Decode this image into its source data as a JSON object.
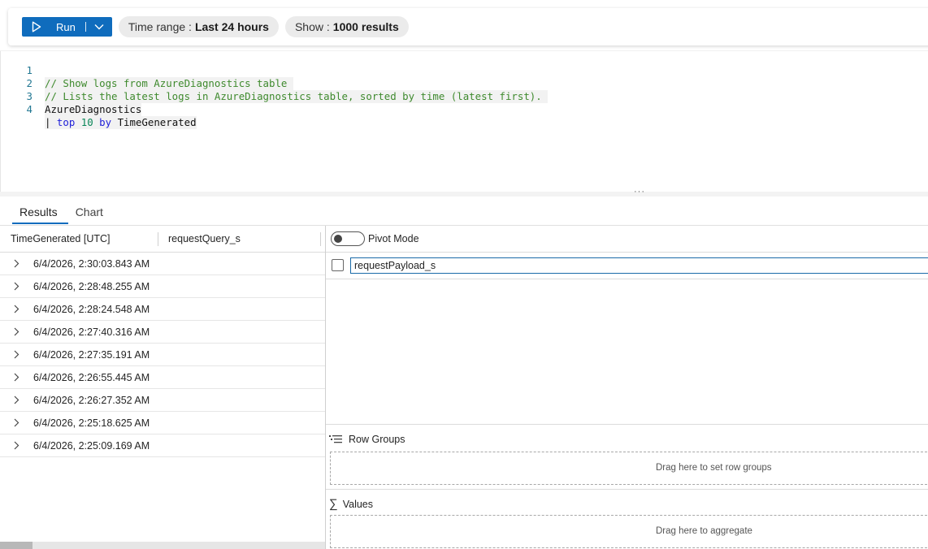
{
  "toolbar": {
    "run_label": "Run",
    "time_range_label": "Time range :",
    "time_range_value": "Last 24 hours",
    "show_label": "Show :",
    "show_value": "1000 results"
  },
  "editor": {
    "lines": [
      {
        "num": "1",
        "text": "// Show logs from AzureDiagnostics table "
      },
      {
        "num": "2",
        "text": "// Lists the latest logs in AzureDiagnostics table, sorted by time (latest first). "
      },
      {
        "num": "3",
        "text": "AzureDiagnostics"
      },
      {
        "num": "4",
        "pipe": "| ",
        "kw1": "top",
        "n": "10",
        "kw2": "by",
        "field": "TimeGenerated"
      }
    ]
  },
  "tabs": [
    {
      "label": "Results",
      "active": true
    },
    {
      "label": "Chart",
      "active": false
    }
  ],
  "grid": {
    "columns": [
      "TimeGenerated [UTC]",
      "requestQuery_s"
    ],
    "rows": [
      "6/4/2026, 2:30:03.843 AM",
      "6/4/2026, 2:28:48.255 AM",
      "6/4/2026, 2:28:24.548 AM",
      "6/4/2026, 2:27:40.316 AM",
      "6/4/2026, 2:27:35.191 AM",
      "6/4/2026, 2:26:55.445 AM",
      "6/4/2026, 2:26:27.352 AM",
      "6/4/2026, 2:25:18.625 AM",
      "6/4/2026, 2:25:09.169 AM"
    ]
  },
  "panel": {
    "pivot_label": "Pivot Mode",
    "column_search_value": "requestPayload_s",
    "row_groups_title": "Row Groups",
    "row_groups_drop": "Drag here to set row groups",
    "values_title": "Values",
    "values_drop": "Drag here to aggregate"
  },
  "colors": {
    "accent": "#0f6cbd",
    "comment": "#3f8a2e",
    "keyword": "#1f1fd8",
    "number": "#098658"
  }
}
